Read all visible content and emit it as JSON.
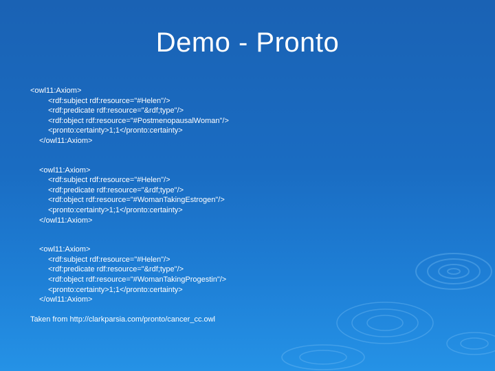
{
  "slide": {
    "title": "Demo - Pronto",
    "axioms": [
      {
        "open": "<owl11:Axiom>",
        "subject": "<rdf:subject rdf:resource=\"#Helen\"/>",
        "predicate": "<rdf:predicate rdf:resource=\"&rdf;type\"/>",
        "object": "<rdf:object rdf:resource=\"#PostmenopausalWoman\"/>",
        "certainty": "<pronto:certainty>1;1</pronto:certainty>",
        "close": "</owl11:Axiom>"
      },
      {
        "open": "<owl11:Axiom>",
        "subject": "<rdf:subject rdf:resource=\"#Helen\"/>",
        "predicate": "<rdf:predicate rdf:resource=\"&rdf;type\"/>",
        "object": "<rdf:object rdf:resource=\"#WomanTakingEstrogen\"/>",
        "certainty": "<pronto:certainty>1;1</pronto:certainty>",
        "close": "</owl11:Axiom>"
      },
      {
        "open": "<owl11:Axiom>",
        "subject": "<rdf:subject rdf:resource=\"#Helen\"/>",
        "predicate": "<rdf:predicate rdf:resource=\"&rdf;type\"/>",
        "object": "<rdf:object rdf:resource=\"#WomanTakingProgestin\"/>",
        "certainty": "<pronto:certainty>1;1</pronto:certainty>",
        "close": "</owl11:Axiom>"
      }
    ],
    "source": "Taken from http://clarkparsia.com/pronto/cancer_cc.owl"
  },
  "colors": {
    "background_top": "#1a62b4",
    "background_bottom": "#2592e6",
    "text": "#ffffff"
  }
}
